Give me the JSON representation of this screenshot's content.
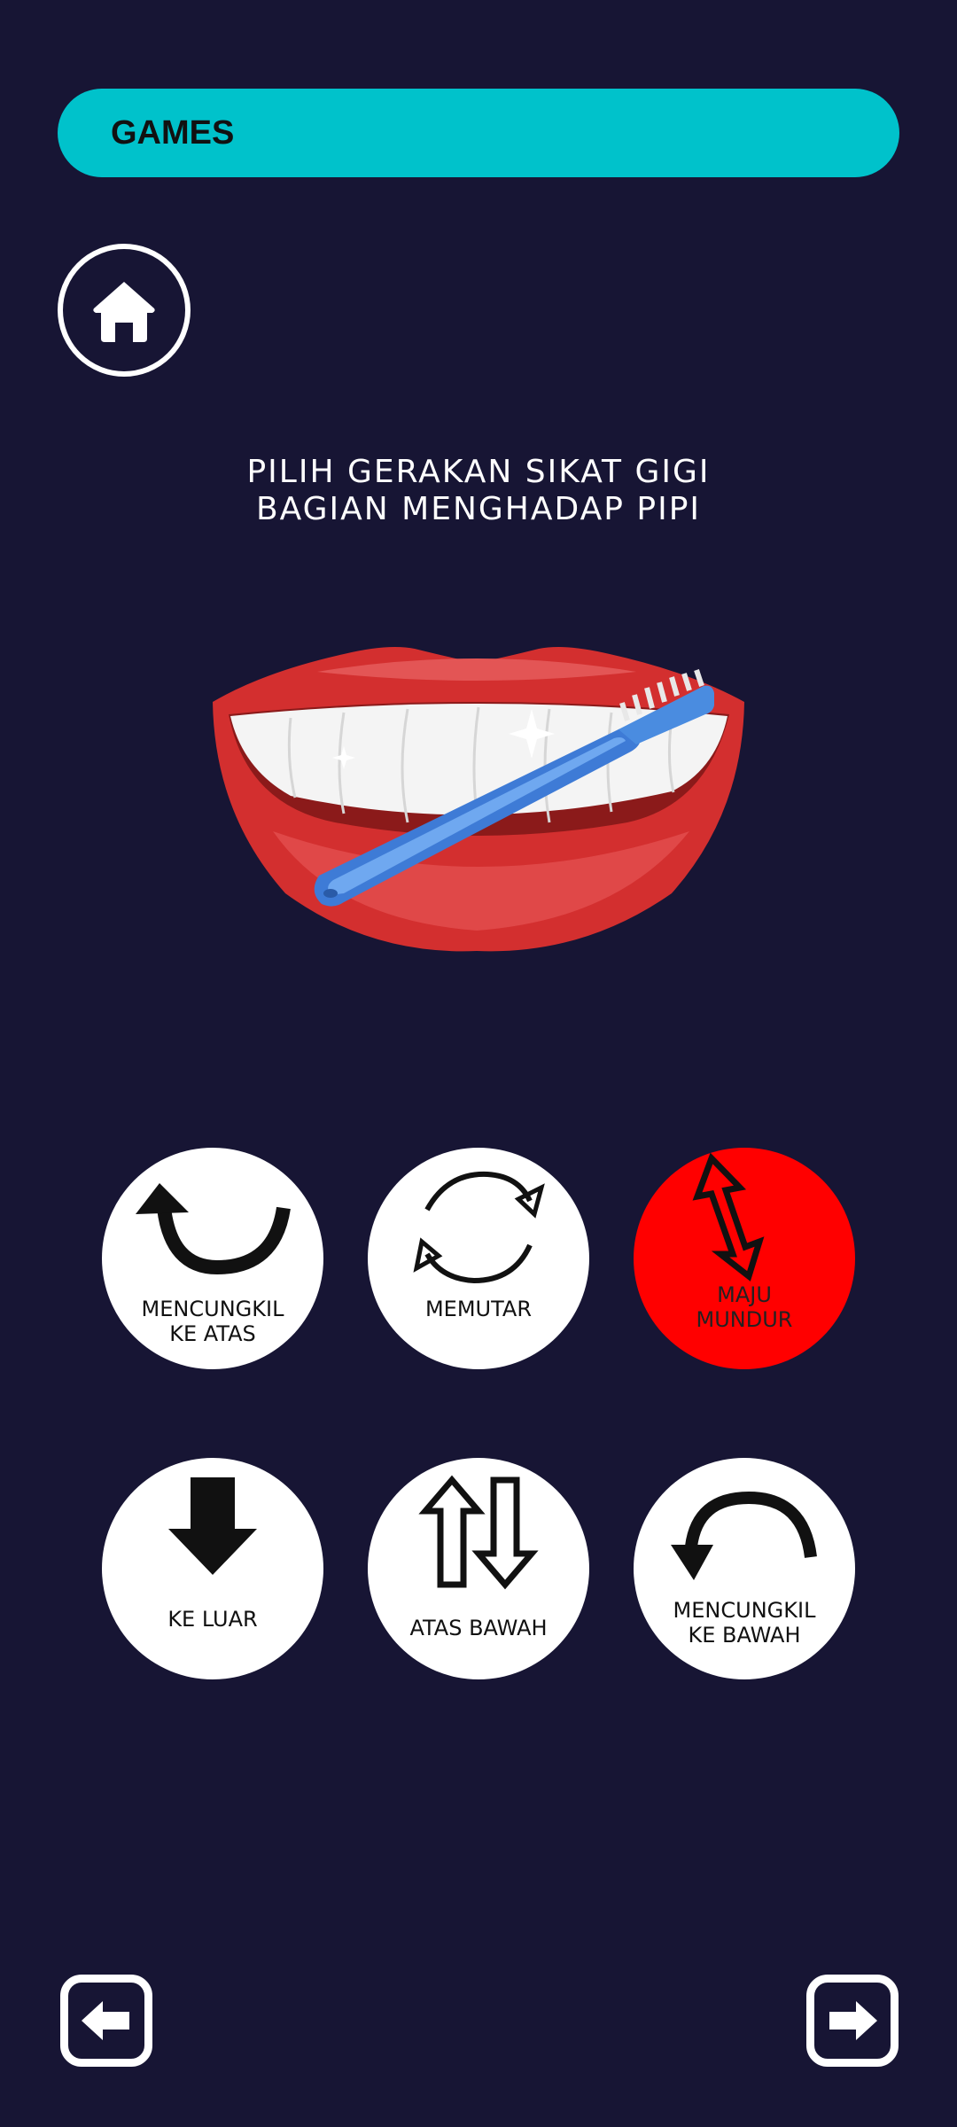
{
  "header": {
    "title": "GAMES"
  },
  "home": {
    "icon": "home-icon"
  },
  "prompt": {
    "line1": "PILIH GERAKAN SIKAT GIGI",
    "line2": "BAGIAN MENGHADAP PIPI"
  },
  "illustration": {
    "subject": "mouth-with-toothbrush"
  },
  "options": [
    {
      "label": "MENCUNGKIL\nKE ATAS",
      "icon": "curved-arrow-up-icon",
      "selected": false
    },
    {
      "label": "MEMUTAR",
      "icon": "rotate-icon",
      "selected": false
    },
    {
      "label": "MAJU\nMUNDUR",
      "icon": "back-forth-arrow-icon",
      "selected": true
    },
    {
      "label": "KE LUAR",
      "icon": "arrow-down-icon",
      "selected": false
    },
    {
      "label": "ATAS BAWAH",
      "icon": "up-down-arrows-icon",
      "selected": false
    },
    {
      "label": "MENCUNGKIL\nKE BAWAH",
      "icon": "curved-arrow-down-icon",
      "selected": false
    }
  ],
  "nav": {
    "back_icon": "arrow-left-icon",
    "next_icon": "arrow-right-icon"
  },
  "colors": {
    "background": "#171534",
    "header": "#00C2CB",
    "selected": "#FF0000",
    "option": "#FFFFFF"
  }
}
